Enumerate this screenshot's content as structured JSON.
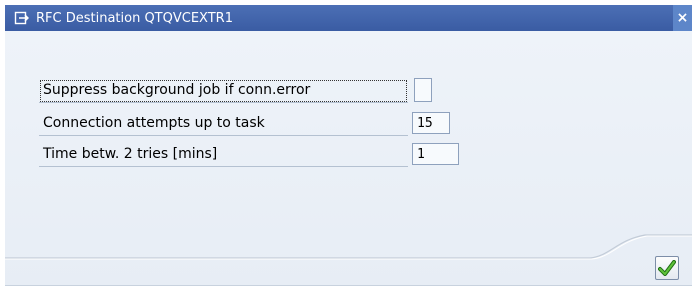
{
  "window": {
    "title": "RFC Destination QTQVCEXTR1",
    "close_glyph": "×"
  },
  "form": {
    "suppress_label": "Suppress background job if conn.error",
    "suppress_checked": false,
    "attempts_label": "Connection attempts up to task",
    "attempts_value": "15",
    "time_label": "Time betw. 2 tries [mins]",
    "time_value": "1"
  },
  "icons": {
    "title_icon": "dialog-arrow-icon",
    "close_icon": "close-icon",
    "confirm_icon": "checkmark-icon"
  },
  "colors": {
    "titlebar": "#3d61aa",
    "body": "#eaf0f7",
    "checkmark": "#2e8b1e"
  }
}
